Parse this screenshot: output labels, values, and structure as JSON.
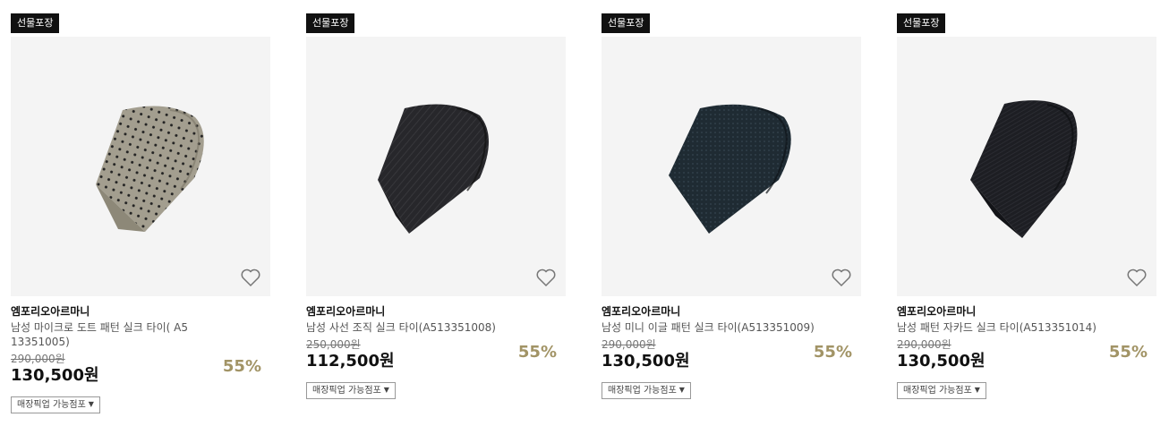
{
  "products": [
    {
      "badge": "선물포장",
      "brand": "엠포리오아르마니",
      "name": "남성 마이크로 도트 패턴 실크 타이( A513351005)",
      "original_price": "290,000원",
      "price": "130,500원",
      "discount": "55%",
      "pickup_label": "매장픽업 가능점포",
      "tie_color": "#a39e8f",
      "tie_pattern": "dots"
    },
    {
      "badge": "선물포장",
      "brand": "엠포리오아르마니",
      "name": "남성 사선 조직 실크 타이(A513351008)",
      "original_price": "250,000원",
      "price": "112,500원",
      "discount": "55%",
      "pickup_label": "매장픽업 가능점포",
      "tie_color": "#26262a",
      "tie_pattern": "diagonal"
    },
    {
      "badge": "선물포장",
      "brand": "엠포리오아르마니",
      "name": "남성 미니 이글 패턴 실크 타이(A513351009)",
      "original_price": "290,000원",
      "price": "130,500원",
      "discount": "55%",
      "pickup_label": "매장픽업 가능점포",
      "tie_color": "#1e2a31",
      "tie_pattern": "mini"
    },
    {
      "badge": "선물포장",
      "brand": "엠포리오아르마니",
      "name": "남성 패턴 자카드 실크 타이(A513351014)",
      "original_price": "290,000원",
      "price": "130,500원",
      "discount": "55%",
      "pickup_label": "매장픽업 가능점포",
      "tie_color": "#1c1d22",
      "tie_pattern": "jacquard"
    }
  ],
  "icons": {
    "wishlist": "heart-outline-icon",
    "dropdown": "caret-down-icon"
  },
  "colors": {
    "badge_bg": "#111111",
    "discount": "#a29466",
    "thumb_bg": "#f4f4f4"
  }
}
